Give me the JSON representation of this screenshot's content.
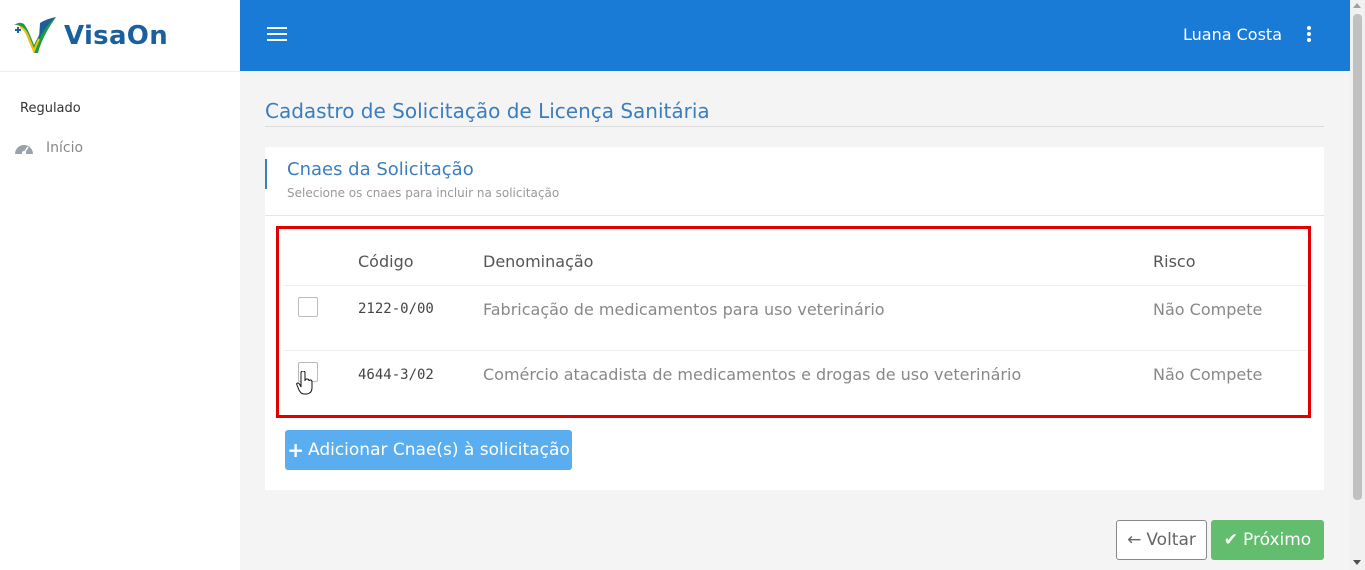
{
  "brand": {
    "name": "VisaOn",
    "logo_icon": "visaon-check-logo"
  },
  "sidebar": {
    "section_label": "Regulado",
    "items": [
      {
        "label": "Início",
        "icon": "dashboard-gauge-icon"
      }
    ]
  },
  "topbar": {
    "user_name": "Luana Costa",
    "menu_icon": "hamburger-icon",
    "more_icon": "kebab-icon"
  },
  "page": {
    "title": "Cadastro de Solicitação de Licença Sanitária"
  },
  "card": {
    "title": "Cnaes da Solicitação",
    "subtitle": "Selecione os cnaes para incluir na solicitação",
    "table": {
      "headers": {
        "code": "Código",
        "name": "Denominação",
        "risk": "Risco"
      },
      "rows": [
        {
          "code": "2122-0/00",
          "name": "Fabricação de medicamentos para uso veterinário",
          "risk": "Não Compete",
          "checked": false
        },
        {
          "code": "4644-3/02",
          "name": "Comércio atacadista de medicamentos e drogas de uso veterinário",
          "risk": "Não Compete",
          "checked": false
        }
      ]
    },
    "add_button": {
      "label": "Adicionar Cnae(s) à solicitação",
      "icon": "plus-icon"
    }
  },
  "footer": {
    "back_button": {
      "label": "Voltar",
      "icon": "arrow-left-icon"
    },
    "next_button": {
      "label": "Próximo",
      "icon": "check-icon"
    }
  },
  "colors": {
    "topbar": "#1a7bd6",
    "accent": "#3a7ec0",
    "highlight_border": "#e00000",
    "add_button": "#5aaef0",
    "next_button": "#62bd6e"
  }
}
